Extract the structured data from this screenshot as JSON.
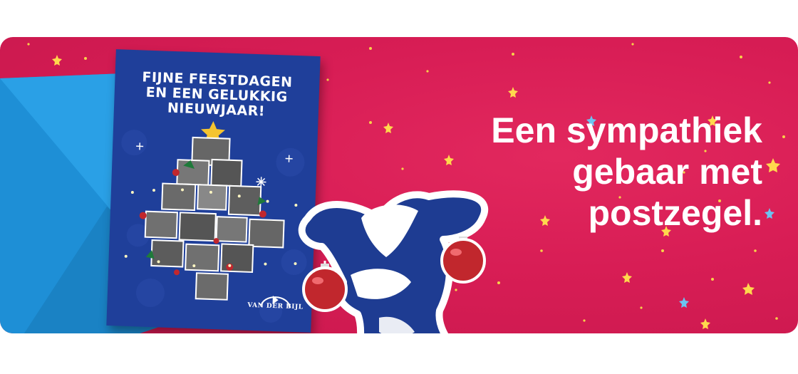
{
  "headline": "Een sympathiek\ngebaar met\npostzegel.",
  "card": {
    "title": "FIJNE FEESTDAGEN\nEN EEN GELUKKIG\nNIEUWJAAR!",
    "logo_text": "VAN DER BIJL"
  },
  "colors": {
    "banner": "#d81d55",
    "card": "#1f3f9a",
    "envelope": "#1e8fd6",
    "cow": "#1e3c92",
    "bauble": "#c1272d",
    "star": "#f4c430"
  },
  "icons": [
    "cow-illustration",
    "christmas-bauble-icon",
    "star-icon",
    "envelope",
    "photo-tree"
  ]
}
